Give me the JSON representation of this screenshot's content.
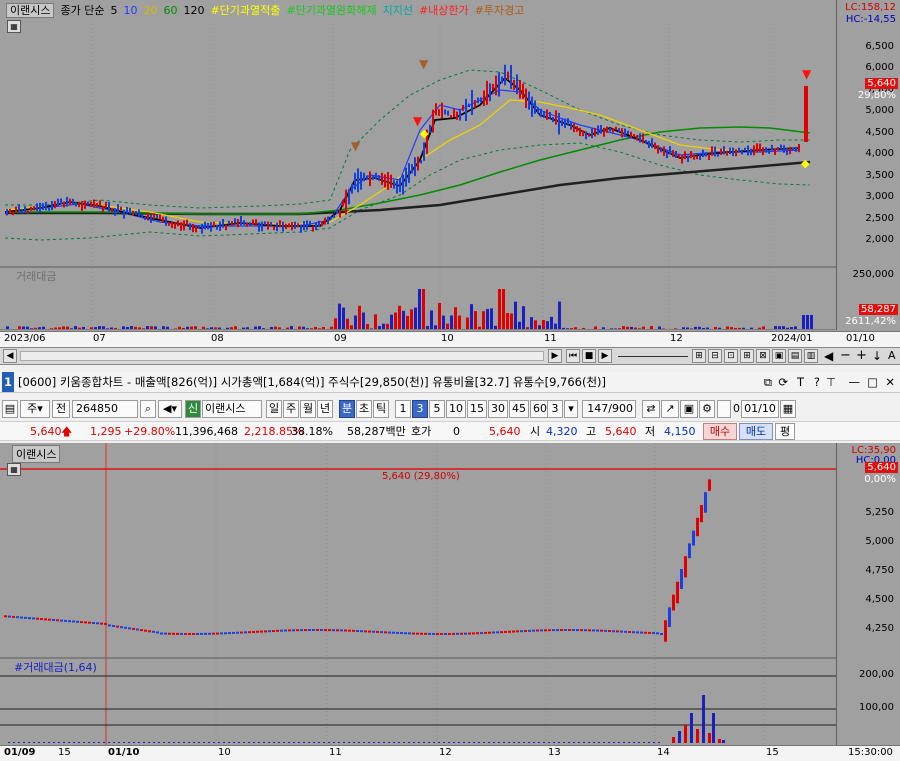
{
  "top_chart": {
    "legend": {
      "name": "이랜시스",
      "ma_label": "종가 단순",
      "ma_periods": [
        "5",
        "10",
        "20",
        "60",
        "120"
      ],
      "ma_colors": [
        "#000000",
        "#1e3cff",
        "#ffd500",
        "#008c00",
        "#000000"
      ],
      "overlays": [
        "#단기과열적출",
        "#단기과열완화해제",
        "지지선",
        "#내상한가",
        "#투자경고"
      ],
      "overlay_colors": [
        "#ffff00",
        "#18c818",
        "#00c0c0",
        "#ff2020",
        "#c06000"
      ]
    },
    "lc": "LC:158,12",
    "hc": "HC:-14,55",
    "price_ticks": [
      "6,500",
      "6,000",
      "5,500",
      "5,000",
      "4,500",
      "4,000",
      "3,500",
      "3,000",
      "2,500",
      "2,000"
    ],
    "current_price_box": "5,640",
    "current_change_box": "29,80%",
    "volume_label": "거래대금",
    "volume_ticks": [
      "250,000"
    ],
    "volume_box": "58,287",
    "volume_pct": "2611,42%",
    "x_ticks": [
      "2023/06",
      "07",
      "08",
      "09",
      "10",
      "11",
      "12",
      "2024/01",
      "01/10"
    ]
  },
  "title_bar": {
    "num": "1",
    "text": "[0600] 키움종합차트 - 매출액[826(억)] 시가총액[1,684(억)] 주식수[29,850(천)] 유통비율[32.7] 유통수[9,766(천)]",
    "icons": [
      "restore-icon",
      "refresh-icon",
      "text-icon",
      "help-icon",
      "minimize-icon",
      "maximize-icon",
      "close-icon"
    ]
  },
  "toolbar": {
    "type1": "주",
    "type2": "전",
    "code": "264850",
    "credit": "신",
    "name": "이랜시스",
    "periods": [
      "일",
      "주",
      "월",
      "년",
      "분",
      "초",
      "틱"
    ],
    "selected_period": "분",
    "intervals": [
      "1",
      "3",
      "5",
      "10",
      "15",
      "30",
      "45",
      "60"
    ],
    "selected_interval": "3",
    "interval_select": "3",
    "count": "147",
    "total": "/900",
    "date_value": "01/10",
    "zero": "0"
  },
  "quote": {
    "price": "5,640",
    "change": "1,295",
    "change_pct": "+29.80%",
    "volume": "11,396,468",
    "vol_pct": "2,218.85%",
    "turnover": "38.18%",
    "amount": "58,287백만",
    "hoga_label": "호가",
    "hoga_value": "0",
    "hoga_price": "5,640",
    "open_label": "시",
    "open": "4,320",
    "high_label": "고",
    "high": "5,640",
    "low_label": "저",
    "low": "4,150",
    "buy_label": "매수",
    "sell_label": "매도",
    "eval_label": "평"
  },
  "bottom_chart": {
    "name": "이랜시스",
    "lc": "LC:35,90",
    "hc": "HC:0,00",
    "price_box": "5,640",
    "pct_box": "0,00%",
    "ref_line_label": "5,640 (29,80%)",
    "price_ticks": [
      "5,250",
      "5,000",
      "4,750",
      "4,500",
      "4,250"
    ],
    "volume_label": "#거래대금(1,64)",
    "volume_ticks": [
      "200,00",
      "100,00"
    ],
    "x_ticks": [
      "01/09",
      "15",
      "01/10",
      "10",
      "11",
      "12",
      "13",
      "14",
      "15"
    ],
    "time_label": "15:30:00"
  }
}
